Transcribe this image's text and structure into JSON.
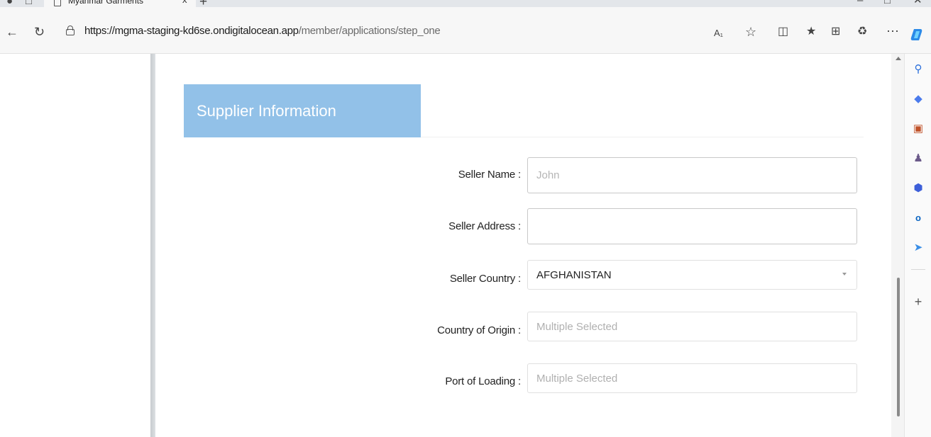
{
  "browser": {
    "tab_title": "Myanmar Garments",
    "tab_close": "x",
    "new_tab": "+",
    "url_domain": "https://mgma-staging-kd6se.ondigitalocean.app",
    "url_path": "/member/applications/step_one"
  },
  "section": {
    "title": "Supplier Information"
  },
  "form": {
    "seller_name": {
      "label": "Seller Name :",
      "placeholder": "John",
      "value": ""
    },
    "seller_address": {
      "label": "Seller Address :",
      "value": ""
    },
    "seller_country": {
      "label": "Seller Country :",
      "value": "AFGHANISTAN"
    },
    "country_of_origin": {
      "label": "Country of Origin :",
      "placeholder": "Multiple Selected"
    },
    "port_of_loading": {
      "label": "Port of Loading :",
      "placeholder": "Multiple Selected"
    }
  },
  "colors": {
    "section_header": "#92c1e8",
    "edge_blue": "#1a73e8"
  },
  "icons": {
    "back": "arrow-left-icon",
    "refresh": "refresh-icon",
    "lock": "lock-icon",
    "read_aloud": "read-aloud-icon",
    "favorite": "star-icon",
    "split": "split-screen-icon",
    "favorites_bar": "favorites-list-icon",
    "collections": "collections-icon",
    "extensions": "extensions-icon",
    "more": "more-icon",
    "copilot": "copilot-icon"
  }
}
